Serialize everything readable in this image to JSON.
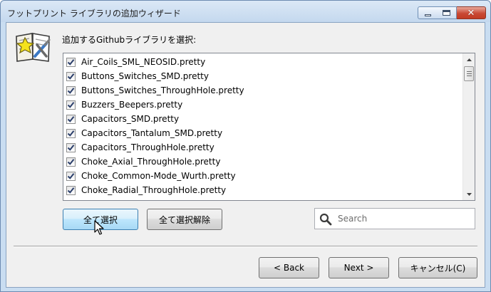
{
  "window": {
    "title": "フットプリント ライブラリの追加ウィザード",
    "icon": "wizard-book-icon"
  },
  "heading": "追加するGithubライブラリを選択:",
  "libraries": [
    {
      "label": "Air_Coils_SML_NEOSID.pretty",
      "checked": true
    },
    {
      "label": "Buttons_Switches_SMD.pretty",
      "checked": true
    },
    {
      "label": "Buttons_Switches_ThroughHole.pretty",
      "checked": true
    },
    {
      "label": "Buzzers_Beepers.pretty",
      "checked": true
    },
    {
      "label": "Capacitors_SMD.pretty",
      "checked": true
    },
    {
      "label": "Capacitors_Tantalum_SMD.pretty",
      "checked": true
    },
    {
      "label": "Capacitors_ThroughHole.pretty",
      "checked": true
    },
    {
      "label": "Choke_Axial_ThroughHole.pretty",
      "checked": true
    },
    {
      "label": "Choke_Common-Mode_Wurth.pretty",
      "checked": true
    },
    {
      "label": "Choke_Radial_ThroughHole.pretty",
      "checked": true
    }
  ],
  "buttons": {
    "select_all": "全て選択",
    "deselect_all": "全て選択解除",
    "back": "< Back",
    "next": "Next >",
    "cancel": "キャンセル(C)"
  },
  "search": {
    "placeholder": "Search",
    "value": ""
  },
  "colors": {
    "checkmark": "#2b3f6b",
    "hover_button": "#bee6fd",
    "close_button": "#c94a35"
  }
}
